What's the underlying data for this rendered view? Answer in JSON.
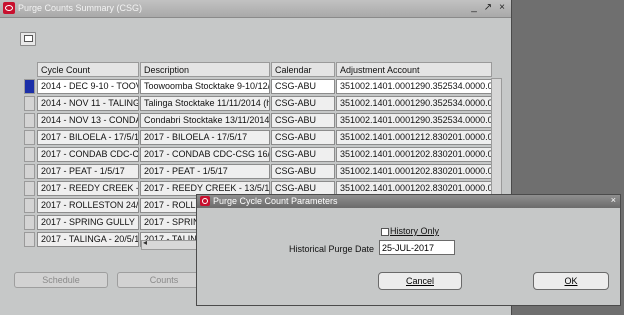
{
  "window": {
    "title": "Purge Counts Summary (CSG)",
    "controls": [
      "_",
      "↗",
      "×"
    ]
  },
  "grid": {
    "columns": [
      "Cycle Count",
      "Description",
      "Calendar",
      "Adjustment Account"
    ],
    "rows": [
      [
        "2014 - DEC 9-10 - TOOV",
        "Toowoomba Stocktake 9-10/12/",
        "CSG-ABU",
        "351002.1401.0001290.352534.0000.000"
      ],
      [
        "2014 - NOV 11 - TALING",
        "Talinga Stocktake 11/11/2014 (h",
        "CSG-ABU",
        "351002.1401.0001290.352534.0000.000"
      ],
      [
        "2014 - NOV 13 - CONDA",
        "Condabri Stocktake 13/11/2014",
        "CSG-ABU",
        "351002.1401.0001290.352534.0000.000"
      ],
      [
        "2017 - BILOELA - 17/5/1",
        "2017 - BILOELA - 17/5/17",
        "CSG-ABU",
        "351002.1401.0001212.830201.0000.000"
      ],
      [
        "2017 - CONDAB CDC-C",
        "2017 - CONDAB CDC-CSG 16/6",
        "CSG-ABU",
        "351002.1401.0001202.830201.0000.000"
      ],
      [
        "2017 - PEAT - 1/5/17",
        "2017 - PEAT - 1/5/17",
        "CSG-ABU",
        "351002.1401.0001202.830201.0000.000"
      ],
      [
        "2017 - REEDY CREEK -",
        "2017 - REEDY CREEK - 13/5/17",
        "CSG-ABU",
        "351002.1401.0001202.830201.0000.000"
      ],
      [
        "2017 - ROLLESTON 24/",
        "2017 - ROLLE",
        "",
        ""
      ],
      [
        "2017 - SPRING GULLY",
        "2017 - SPRIN",
        "",
        ""
      ],
      [
        "2017 - TALINGA - 20/5/1",
        "2017 - TALIN",
        "",
        ""
      ]
    ]
  },
  "buttons": {
    "schedule": "Schedule",
    "counts": "Counts"
  },
  "dialog": {
    "title": "Purge Cycle Count Parameters",
    "close": "×",
    "history_only_label": "History Only",
    "purge_date_label": "Historical Purge Date",
    "purge_date_value": "25-JUL-2017",
    "cancel": "Cancel",
    "ok": "OK"
  }
}
